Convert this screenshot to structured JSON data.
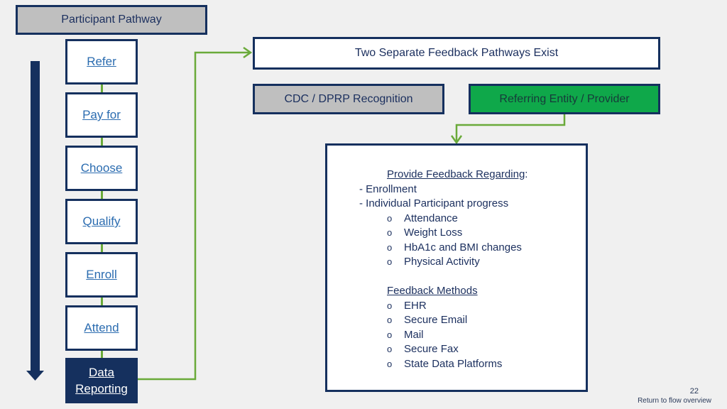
{
  "title": "Participant Pathway",
  "steps": [
    {
      "label": "Refer"
    },
    {
      "label": "Pay for"
    },
    {
      "label": "Choose"
    },
    {
      "label": "Qualify"
    },
    {
      "label": "Enroll"
    },
    {
      "label": "Attend"
    },
    {
      "label_line1": "Data",
      "label_line2": "Reporting",
      "active": true
    }
  ],
  "header": "Two Separate Feedback Pathways Exist",
  "pathways": {
    "cdc": "CDC / DPRP Recognition",
    "referring": "Referring Entity / Provider"
  },
  "feedback": {
    "heading": "Provide Feedback Regarding",
    "heading_suffix": ":",
    "items": [
      "- Enrollment",
      "- Individual Participant progress"
    ],
    "sub_items": [
      "Attendance",
      "Weight Loss",
      "HbA1c and BMI changes",
      "Physical Activity"
    ],
    "methods_heading": "Feedback Methods",
    "methods": [
      "EHR",
      "Secure Email",
      "Mail",
      "Secure Fax",
      "State Data Platforms"
    ],
    "bullet": "o"
  },
  "footer": {
    "page_number": "22",
    "return_link": "Return to flow overview"
  },
  "colors": {
    "navy": "#15305e",
    "green_line": "#6aaa3a",
    "green_fill": "#0fa84a",
    "gray_fill": "#bfbfbf",
    "link_blue": "#2b6cb0"
  }
}
